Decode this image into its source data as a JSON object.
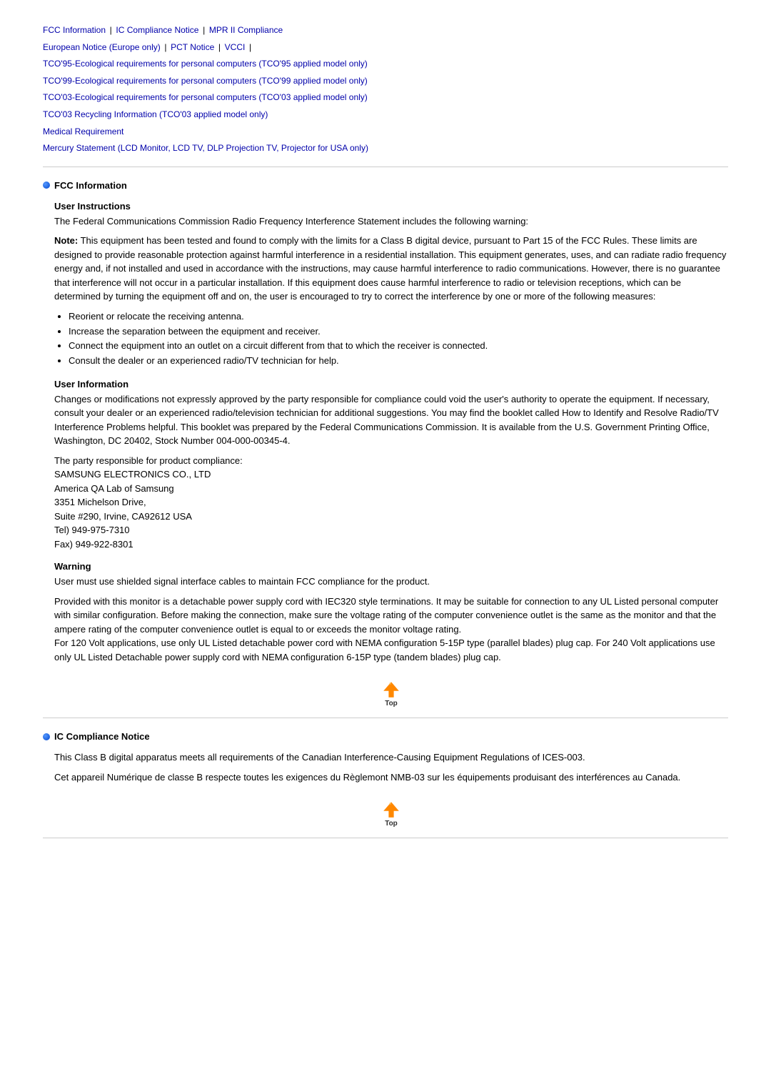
{
  "nav": {
    "links": [
      {
        "label": "FCC Information",
        "id": "fcc"
      },
      {
        "label": "IC Compliance Notice",
        "id": "ic"
      },
      {
        "label": "MPR II Compliance",
        "id": "mpr"
      },
      {
        "label": "European Notice (Europe only)",
        "id": "eu"
      },
      {
        "label": "PCT Notice",
        "id": "pct"
      },
      {
        "label": "VCCI",
        "id": "vcci"
      },
      {
        "label": "TCO'95-Ecological requirements for personal computers (TCO'95 applied model only)",
        "id": "tco95"
      },
      {
        "label": "TCO'99-Ecological requirements for personal computers (TCO'99 applied model only)",
        "id": "tco99"
      },
      {
        "label": "TCO'03-Ecological requirements for personal computers (TCO'03 applied model only)",
        "id": "tco03"
      },
      {
        "label": "TCO'03 Recycling Information (TCO'03 applied model only)",
        "id": "tco03r"
      },
      {
        "label": "Medical Requirement",
        "id": "medical"
      },
      {
        "label": "Mercury Statement (LCD Monitor, LCD TV, DLP Projection TV, Projector for USA only)",
        "id": "mercury"
      }
    ]
  },
  "sections": [
    {
      "id": "fcc",
      "title": "FCC Information",
      "subsections": [
        {
          "title": "User Instructions",
          "paragraphs": [
            "The Federal Communications Commission Radio Frequency Interference Statement includes the following warning:",
            ""
          ],
          "note_bold": "Note:",
          "note_text": " This equipment has been tested and found to comply with the limits for a Class B digital device, pursuant to Part 15 of the FCC Rules. These limits are designed to provide reasonable protection against harmful interference in a residential installation. This equipment generates, uses, and can radiate radio frequency energy and, if not installed and used in accordance with the instructions, may cause harmful interference to radio communications. However, there is no guarantee that interference will not occur in a particular installation. If this equipment does cause harmful interference to radio or television receptions, which can be determined by turning the equipment off and on, the user is encouraged to try to correct the interference by one or more of the following measures:",
          "bullets": [
            "Reorient or relocate the receiving antenna.",
            "Increase the separation between the equipment and receiver.",
            "Connect the equipment into an outlet on a circuit different from that to which the receiver is connected.",
            "Consult the dealer or an experienced radio/TV technician for help."
          ]
        },
        {
          "title": "User Information",
          "paragraphs": [
            "Changes or modifications not expressly approved by the party responsible for compliance could void the user's authority to operate the equipment. If necessary, consult your dealer or an experienced radio/television technician for additional suggestions. You may find the booklet called How to Identify and Resolve Radio/TV Interference Problems helpful. This booklet was prepared by the Federal Communications Commission. It is available from the U.S. Government Printing Office, Washington, DC 20402, Stock Number 004-000-00345-4.",
            "The party responsible for product compliance:\nSAMSUNG ELECTRONICS CO., LTD\nAmerica QA Lab of Samsung\n3351 Michelson Drive,\nSuite #290, Irvine, CA92612 USA\nTel) 949-975-7310\nFax) 949-922-8301"
          ]
        },
        {
          "title": "Warning",
          "paragraphs": [
            "User must use shielded signal interface cables to maintain FCC compliance for the product.",
            "Provided with this monitor is a detachable power supply cord with IEC320 style terminations. It may be suitable for connection to any UL Listed personal computer with similar configuration. Before making the connection, make sure the voltage rating of the computer convenience outlet is the same as the monitor and that the ampere rating of the computer convenience outlet is equal to or exceeds the monitor voltage rating.\nFor 120 Volt applications, use only UL Listed detachable power cord with NEMA configuration 5-15P type (parallel blades) plug cap. For 240 Volt applications use only UL Listed Detachable power supply cord with NEMA configuration 6-15P type (tandem blades) plug cap."
          ]
        }
      ]
    },
    {
      "id": "ic",
      "title": "IC Compliance Notice",
      "paragraphs": [
        "This Class B digital apparatus meets all requirements of the Canadian Interference-Causing Equipment Regulations of ICES-003.",
        "Cet appareil Numérique de classe B respecte toutes les exigences du Règlemont NMB-03 sur les équipements produisant des interférences au Canada."
      ]
    }
  ],
  "top_button_label": "Top"
}
